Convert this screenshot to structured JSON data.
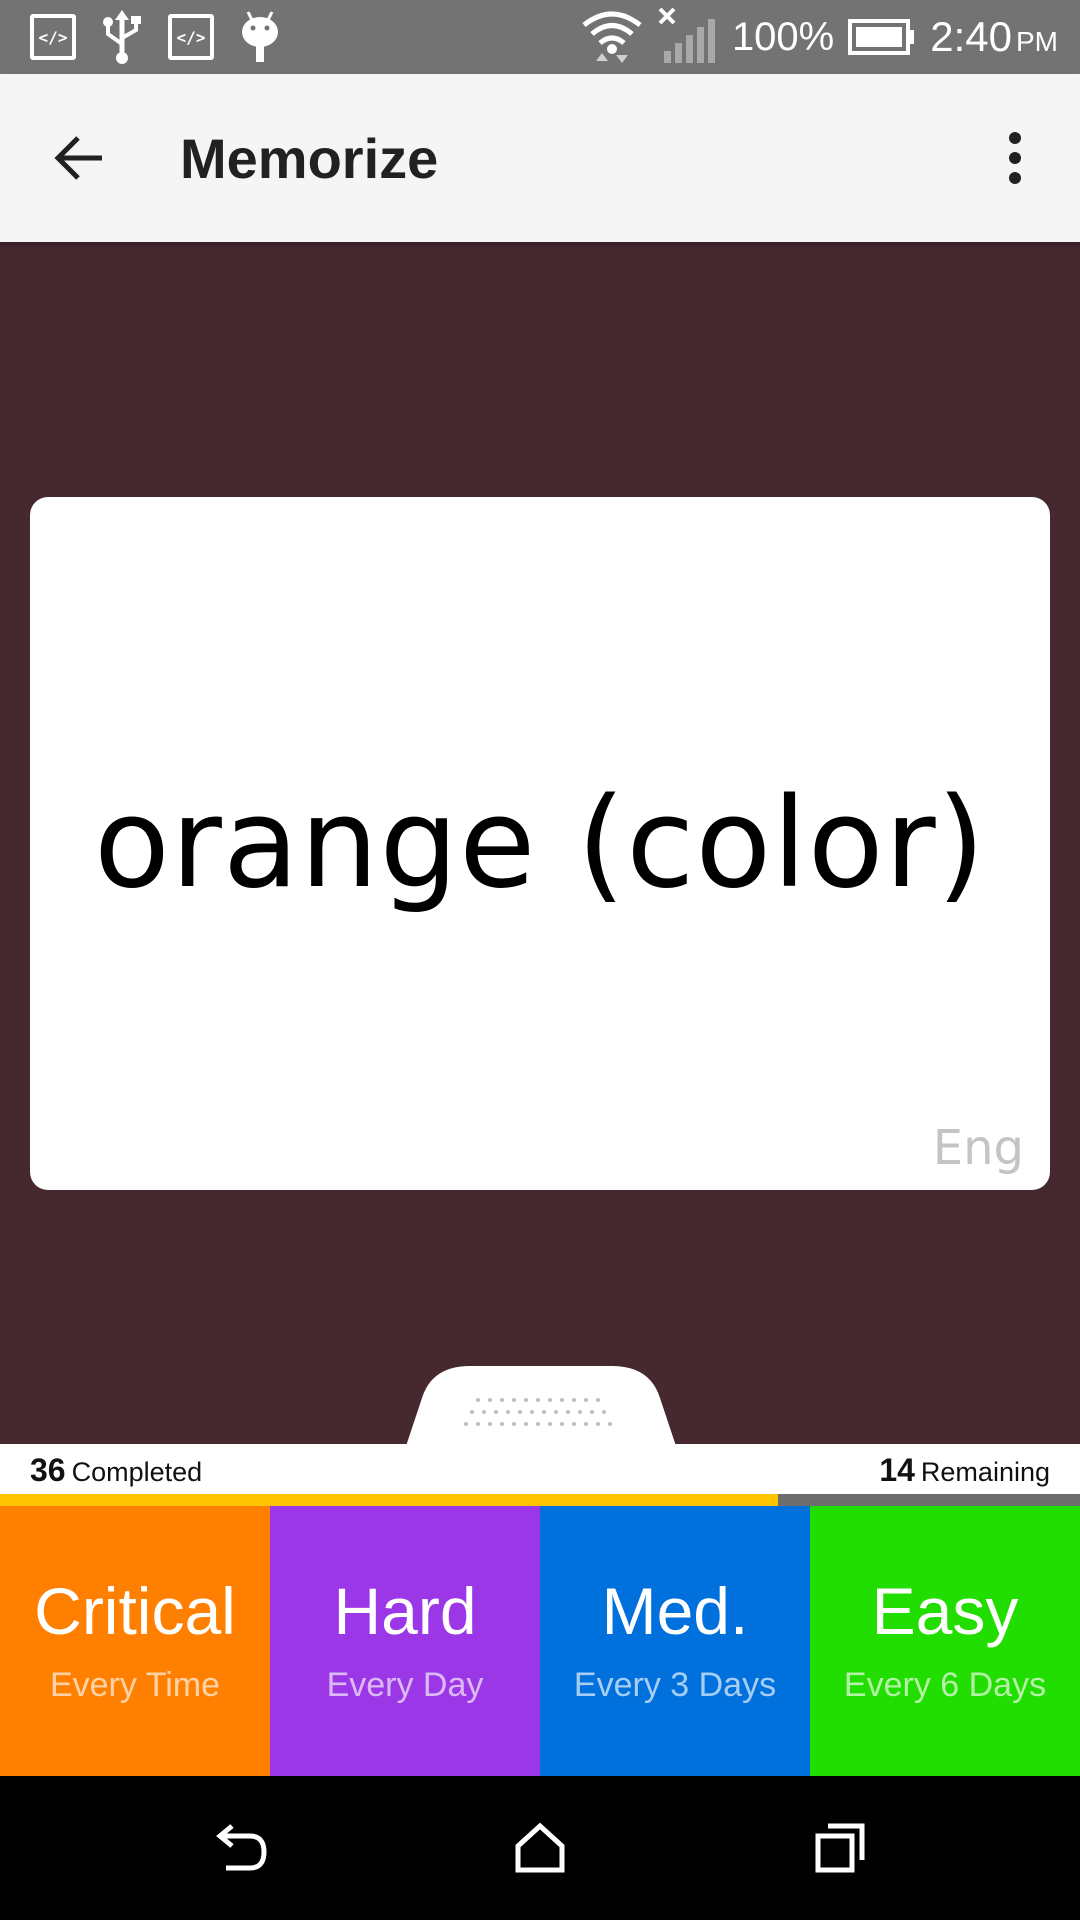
{
  "status_bar": {
    "icons": [
      "code-icon",
      "usb-icon",
      "code-icon",
      "android-icon"
    ],
    "battery_text": "100%",
    "time": "2:40",
    "ampm": "PM"
  },
  "app_bar": {
    "title": "Memorize"
  },
  "card": {
    "word": "orange (color)",
    "language": "Eng"
  },
  "progress": {
    "completed_count": "36",
    "completed_label": "Completed",
    "remaining_count": "14",
    "remaining_label": "Remaining",
    "fraction_complete": 0.72
  },
  "ratings": [
    {
      "label": "Critical",
      "sub": "Every Time",
      "color": "#ff8000"
    },
    {
      "label": "Hard",
      "sub": "Every Day",
      "color": "#9b37e6"
    },
    {
      "label": "Med.",
      "sub": "Every 3 Days",
      "color": "#0070dd"
    },
    {
      "label": "Easy",
      "sub": "Every 6 Days",
      "color": "#22dd00"
    }
  ],
  "colors": {
    "background": "#46282f",
    "progress_fill": "#ffc400"
  }
}
